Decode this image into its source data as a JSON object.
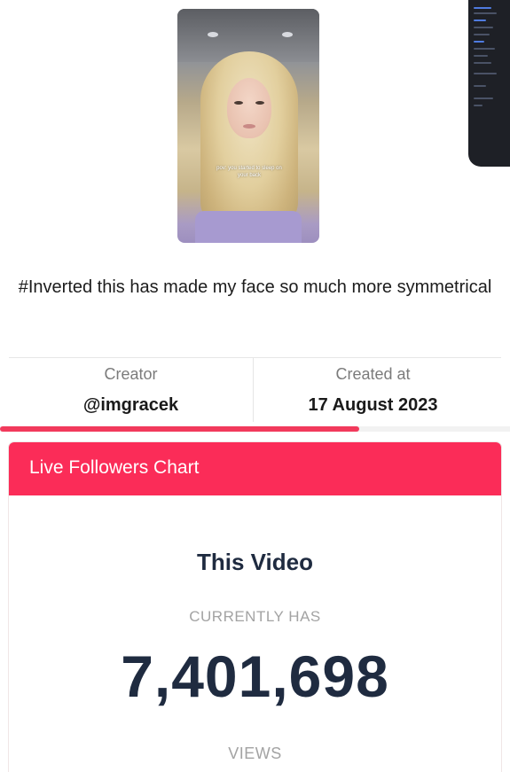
{
  "video": {
    "thumbnail_caption": "pov: you started to sleep on your back",
    "description": "#Inverted this has made my face so much more symmetrical"
  },
  "info": {
    "creator_label": "Creator",
    "creator_value": "@imgracek",
    "created_label": "Created at",
    "created_value": "17 August 2023"
  },
  "progress": {
    "fraction": 0.705,
    "color": "#f23a5c"
  },
  "card": {
    "header_title": "Live Followers Chart",
    "header_color": "#fb2c58",
    "subject": "This Video",
    "currently_label": "CURRENTLY HAS",
    "count": "7,401,698",
    "unit_label": "VIEWS"
  }
}
